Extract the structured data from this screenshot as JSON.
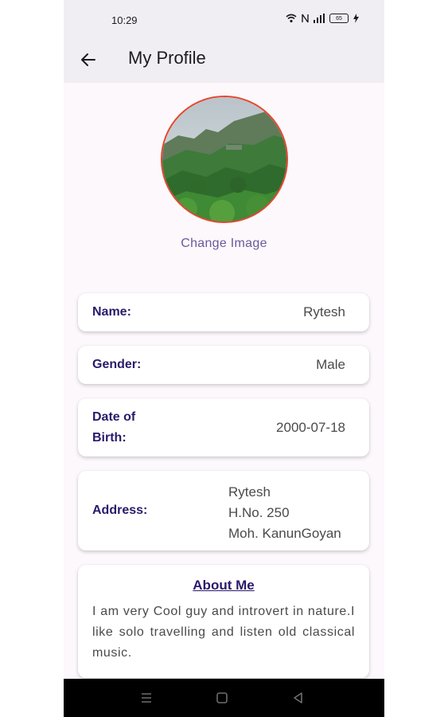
{
  "status_bar": {
    "time": "10:29",
    "battery": "65",
    "icons": [
      "wifi-icon",
      "nfc-icon",
      "signal-icon",
      "battery-icon",
      "charging-icon"
    ]
  },
  "app_bar": {
    "title": "My Profile",
    "back_icon": "arrow-left-icon"
  },
  "profile": {
    "change_image_label": "Change Image",
    "avatar_border_color": "#e6462e"
  },
  "fields": {
    "name": {
      "label": "Name:",
      "value": "Rytesh"
    },
    "gender": {
      "label": "Gender:",
      "value": "Male"
    },
    "dob": {
      "label_line1": "Date of",
      "label_line2": "Birth:",
      "value": "2000-07-18"
    },
    "address": {
      "label": "Address:",
      "lines": [
        "Rytesh",
        "H.No. 250",
        "Moh. KanunGoyan"
      ]
    }
  },
  "about": {
    "title": "About Me",
    "text": "I am very Cool guy and introvert in nature.I like solo travelling and listen old classical music."
  },
  "nav_bar": {
    "items": [
      "menu-icon",
      "home-square-icon",
      "back-triangle-icon"
    ]
  },
  "colors": {
    "accent_text": "#2a1a6b",
    "link": "#6a5a9a",
    "appbar_bg": "#f1eef3",
    "page_bg": "#fcf8fc"
  }
}
